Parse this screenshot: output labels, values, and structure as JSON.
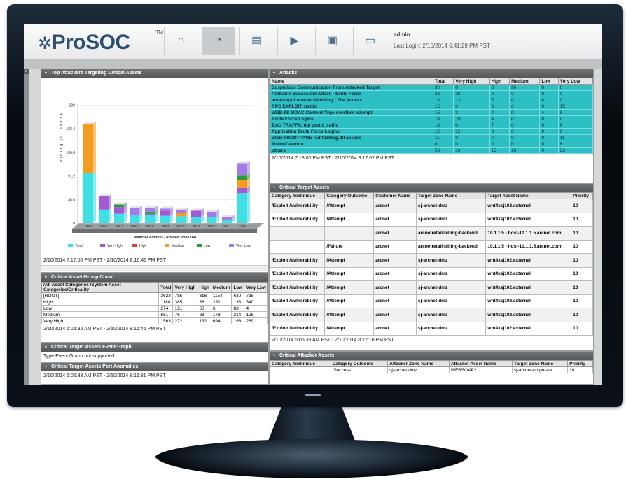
{
  "app": {
    "logo_text": "ProSOC",
    "logo_tm": "TM"
  },
  "nav": [
    {
      "name": "home-icon",
      "glyph": "⌂"
    },
    {
      "name": "dashboard-gauge-icon",
      "glyph": "◔"
    },
    {
      "name": "report-book-icon",
      "glyph": "▤"
    },
    {
      "name": "play-icon",
      "glyph": "▶"
    },
    {
      "name": "lock-icon",
      "glyph": "▣"
    },
    {
      "name": "chat-icon",
      "glyph": "▭"
    }
  ],
  "user": {
    "name": "admin",
    "last_login": "Last Login: 2/10/2014 6:41:29 PM PST"
  },
  "top_attackers": {
    "title": "Top Attackers Targeting Critical Assets",
    "footer": "2/10/2014 7:17:00 PM PST - 2/10/2014 8:16:46 PM PST"
  },
  "chart_data": {
    "type": "bar",
    "title": "",
    "ylabel": "Number of Events",
    "xlabel": "Attacker Address | Attacker Zone URI",
    "ylim": [
      0,
      230
    ],
    "yticks": [
      "0",
      "45.6",
      "91.2",
      "136.8",
      "182.4",
      "228"
    ],
    "categories": [
      "199.2",
      "209.1",
      "209.1",
      "209.1",
      "209.6",
      "209.1",
      "63.19",
      "209.1",
      "209.1",
      "209.1",
      "[othe"
    ],
    "series": [
      {
        "name": "Total",
        "color": "#3ee0e6",
        "values": [
          96,
          26,
          18,
          15,
          15,
          14,
          13,
          12,
          11,
          6,
          58
        ]
      },
      {
        "name": "Very High",
        "color": "#a05ad6",
        "values": [
          0,
          26,
          13,
          0,
          3,
          10,
          0,
          12,
          0,
          0,
          10
        ]
      },
      {
        "name": "High",
        "color": "#d8452e",
        "values": [
          0,
          0,
          0,
          0,
          0,
          0,
          0,
          0,
          0,
          0,
          0
        ]
      },
      {
        "name": "Medium",
        "color": "#f39c1e",
        "values": [
          96,
          0,
          0,
          0,
          0,
          0,
          7,
          0,
          0,
          0,
          15
        ]
      },
      {
        "name": "Low",
        "color": "#2b9c3a",
        "values": [
          0,
          0,
          5,
          0,
          4,
          0,
          0,
          0,
          0,
          0,
          10
        ]
      },
      {
        "name": "Very Low",
        "color": "#a57ce6",
        "values": [
          0,
          0,
          0,
          15,
          8,
          4,
          6,
          0,
          11,
          6,
          23
        ]
      }
    ]
  },
  "asset_group": {
    "title": "Critical Asset Group Count",
    "headers": [
      "/All Asset Categories /System Asset Categories/Criticality",
      "Total",
      "Very High",
      "High",
      "Medium",
      "Low",
      "Very Low"
    ],
    "rows": [
      [
        "[ROOT]",
        "3623",
        "785",
        "316",
        "1154",
        "630",
        "738"
      ],
      [
        "High",
        "1180",
        "385",
        "36",
        "281",
        "138",
        "340"
      ],
      [
        "Low",
        "274",
        "121",
        "60",
        "6",
        "83",
        "4"
      ],
      [
        "Medium",
        "681",
        "76",
        "88",
        "178",
        "214",
        "125"
      ],
      [
        "Very High",
        "1563",
        "272",
        "132",
        "694",
        "196",
        "269"
      ]
    ],
    "footer": "2/10/2014 6:05:32 AM PST - 2/10/2014 8:16:46 PM PST"
  },
  "event_graph": {
    "title": "Critical Target Assets Event Graph",
    "message": "Type Event Graph not supported"
  },
  "port_anomalies": {
    "title": "Critical Target Assets Port Anomalies",
    "footer": "2/10/2014 6:05:33 AM PST - 2/10/2014 8:16:31 PM PST"
  },
  "attacks": {
    "title": "Attacks",
    "headers": [
      "Name",
      "Total",
      "Very High",
      "High",
      "Medium",
      "Low",
      "Very Low"
    ],
    "rows": [
      [
        "Suspicious Communication From Attacked Target",
        "96",
        "0",
        "0",
        "96",
        "0",
        "0"
      ],
      [
        "Probable Successful Attack - Brute Force",
        "26",
        "26",
        "0",
        "0",
        "0",
        "0"
      ],
      [
        "antercept Console Shielding - File Access",
        "18",
        "13",
        "5",
        "0",
        "0",
        "0"
      ],
      [
        "RPC EXPLOIT statdx",
        "15",
        "0",
        "0",
        "0",
        "0",
        "15"
      ],
      [
        "WEB-IIS MDAC Content-Type overflow attempt",
        "15",
        "3",
        "0",
        "0",
        "4",
        "8"
      ],
      [
        "Brute Force Logins",
        "14",
        "10",
        "4",
        "0",
        "0",
        "0"
      ],
      [
        "BAD TRAFFIC tcp port 0 traffic",
        "13",
        "0",
        "7",
        "0",
        "0",
        "6"
      ],
      [
        "Application Brute Force Logins",
        "12",
        "12",
        "0",
        "0",
        "0",
        "0"
      ],
      [
        "WEB-FRONTPAGE rad fp30reg.dll access",
        "11",
        "0",
        "0",
        "0",
        "0",
        "11"
      ],
      [
        "TrinooDaemon",
        "6",
        "0",
        "0",
        "0",
        "0",
        "6"
      ],
      [
        "others",
        "58",
        "10",
        "15",
        "10",
        "0",
        "23"
      ]
    ],
    "footer": "2/10/2014 7:18:00 PM PST - 2/10/2014 8:17:02 PM PST"
  },
  "critical_targets": {
    "title": "Critical Target Assets",
    "headers": [
      "Category Technique",
      "Category Outcome",
      "Customer Name",
      "Target Zone Name",
      "Target Asset Name",
      "Priority"
    ],
    "rows": [
      [
        "/Exploit /Vulnerability",
        "/Attempt",
        "arcnet",
        "sj-arcnet-dmz",
        "wnt4xsj102.external",
        "10"
      ],
      [
        "/Exploit /Vulnerability",
        "/Attempt",
        "arcnet",
        "sj-arcnet-dmz",
        "wnt4xsj102.external",
        "10"
      ],
      [
        "",
        "",
        "arcnet",
        "arcnetretail-billing-backend",
        "10.1.1.5 - host-10.1.1.5.arcnet.com",
        "10"
      ],
      [
        "",
        "/Failure",
        "arcnet",
        "arcnetretail-billing-backend",
        "10.1.1.5 - host-10.1.1.5.arcnet.com",
        "10"
      ],
      [
        "/Exploit /Vulnerability",
        "/Attempt",
        "arcnet",
        "sj-arcnet-dmz",
        "wnt4xsj102.external",
        "10"
      ],
      [
        "/Exploit /Vulnerability",
        "/Attempt",
        "arcnet",
        "sj-arcnet-dmz",
        "wnt4xsj102.external",
        "10"
      ],
      [
        "/Exploit /Vulnerability",
        "/Attempt",
        "arcnet",
        "sj-arcnet-dmz",
        "wnt4xsj102.external",
        "10"
      ],
      [
        "/Exploit /Vulnerability",
        "/Attempt",
        "arcnet",
        "sj-arcnet-dmz",
        "wnt4xsj102.external",
        "10"
      ],
      [
        "/Exploit /Vulnerability",
        "/Attempt",
        "arcnet",
        "sj-arcnet-dmz",
        "wnt4xsj102.external",
        "10"
      ],
      [
        "/Exploit /Vulnerability",
        "/Attempt",
        "arcnet",
        "sj-arcnet-dmz",
        "wnt4xsj102.external",
        "10"
      ]
    ],
    "footer": "2/10/2014 6:05:33 AM PST - 2/10/2014 8:12:16 PM PST"
  },
  "critical_attackers": {
    "title": "Critical Attacker Assets",
    "headers": [
      "Category Technique",
      "Category Outcome",
      "Attacker Zone Name",
      "Attacker Asset Name",
      "Target Zone Name",
      "Priority"
    ],
    "rows": [
      [
        "",
        "/Success",
        "sj-arcnet-dmz",
        "WEBSOAP2",
        "sj-arcnet-corporate",
        "10"
      ]
    ]
  }
}
